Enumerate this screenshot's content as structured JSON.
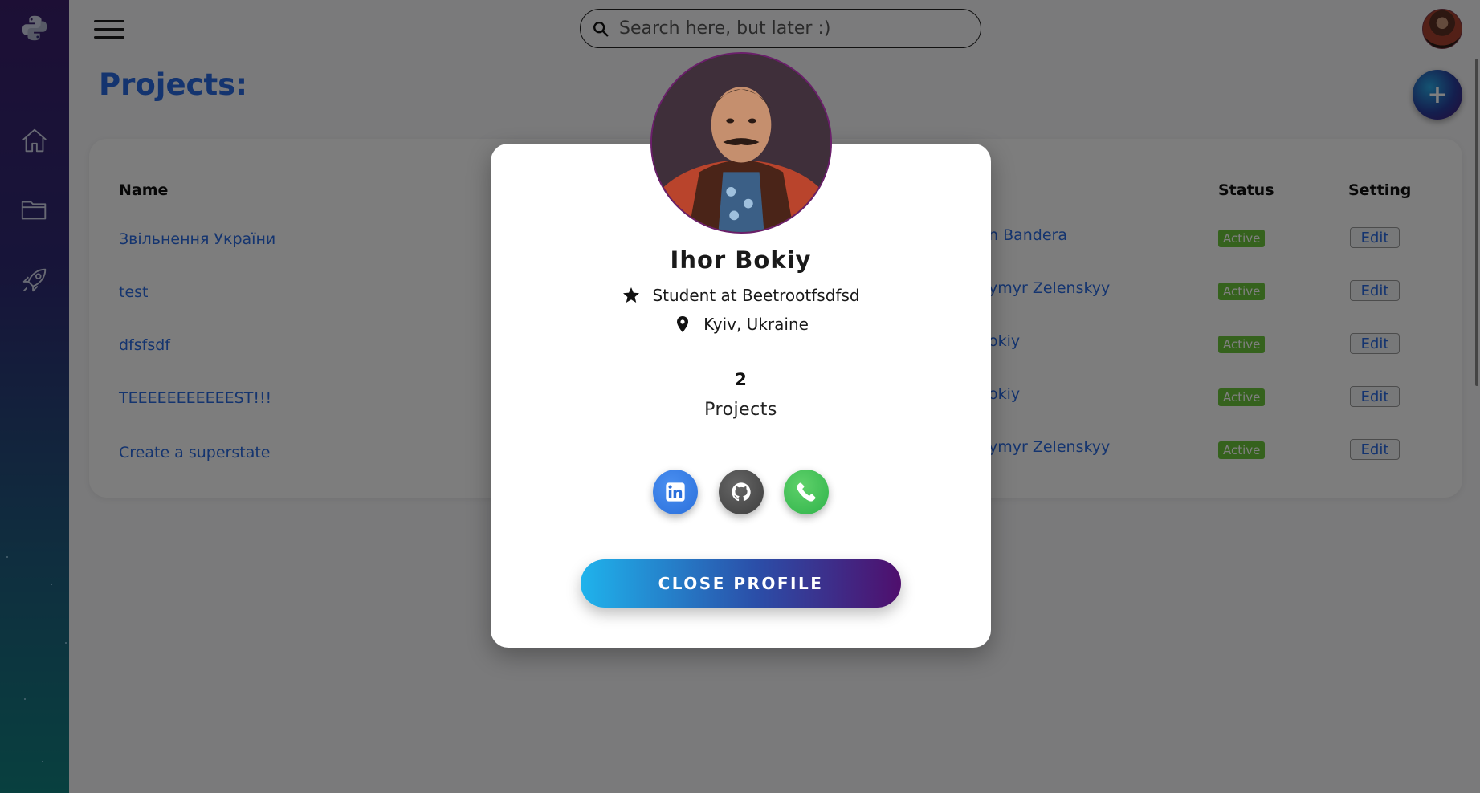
{
  "header": {
    "menu_icon": "hamburger-icon",
    "search": {
      "placeholder": "Search here, but later :)",
      "value": ""
    },
    "avatar_alt": "user-avatar"
  },
  "sidebar": {
    "items": [
      {
        "icon": "python-logo"
      },
      {
        "icon": "home-icon"
      },
      {
        "icon": "folder-icon"
      },
      {
        "icon": "rocket-icon"
      }
    ]
  },
  "page": {
    "title": "Projects:",
    "add_button": "+"
  },
  "table": {
    "headers": {
      "name": "Name",
      "status": "Status",
      "setting": "Setting"
    },
    "rows": [
      {
        "name": "Звільнення України",
        "owner": "n Bandera",
        "status": "Active",
        "action": "Edit"
      },
      {
        "name": "test",
        "owner": "ymyr Zelenskyy",
        "status": "Active",
        "action": "Edit"
      },
      {
        "name": "dfsfsdf",
        "owner": "okiy",
        "status": "Active",
        "action": "Edit"
      },
      {
        "name": "TEEEEEEEEEEEST!!!",
        "owner": "okiy",
        "status": "Active",
        "action": "Edit"
      },
      {
        "name": "Create a superstate",
        "owner": "ymyr Zelenskyy",
        "status": "Active",
        "action": "Edit"
      }
    ]
  },
  "profile_modal": {
    "name": "Ihor Bokiy",
    "occupation": "Student at Beetrootfsdfsd",
    "location": "Kyiv, Ukraine",
    "projects_count": "2",
    "projects_label": "Projects",
    "socials": [
      {
        "icon": "linkedin-icon",
        "color": "#2a6fdb"
      },
      {
        "icon": "github-icon",
        "color": "#444444"
      },
      {
        "icon": "phone-icon",
        "color": "#2fb34a"
      }
    ],
    "close_label": "CLOSE PROFILE"
  },
  "colors": {
    "accent": "#2868df",
    "status_active": "#6bc43a"
  }
}
